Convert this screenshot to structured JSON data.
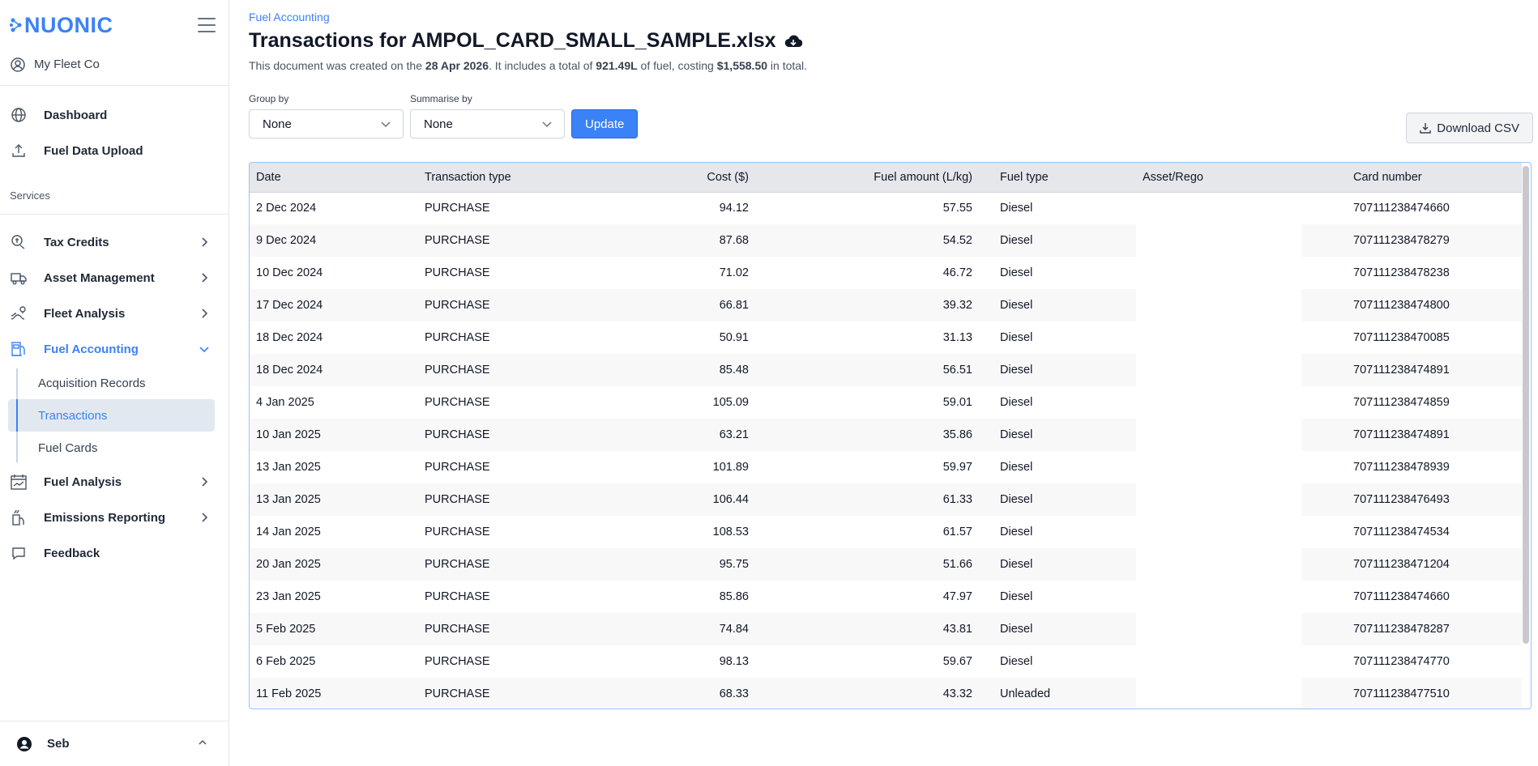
{
  "brand": {
    "logo_text": "NUONIC",
    "accent": "#3b82f6"
  },
  "sidebar": {
    "org_name": "My Fleet Co",
    "top_items": [
      {
        "label": "Dashboard",
        "icon": "globe-icon"
      },
      {
        "label": "Fuel Data Upload",
        "icon": "upload-icon"
      }
    ],
    "section_label": "Services",
    "items": [
      {
        "label": "Tax Credits",
        "icon": "tax-credits-icon"
      },
      {
        "label": "Asset Management",
        "icon": "truck-icon"
      },
      {
        "label": "Fleet Analysis",
        "icon": "route-icon"
      },
      {
        "label": "Fuel Accounting",
        "icon": "fuel-pump-icon",
        "active": true
      },
      {
        "label": "Fuel Analysis",
        "icon": "calendar-chart-icon"
      },
      {
        "label": "Emissions Reporting",
        "icon": "emissions-icon"
      },
      {
        "label": "Feedback",
        "icon": "chat-icon"
      }
    ],
    "fuel_accounting_sub": [
      "Acquisition Records",
      "Transactions",
      "Fuel Cards"
    ],
    "active_sub": "Transactions",
    "user_name": "Seb"
  },
  "main": {
    "breadcrumb": "Fuel Accounting",
    "title": "Transactions for AMPOL_CARD_SMALL_SAMPLE.xlsx",
    "subtitle": {
      "p1": "This document was created on the ",
      "date": "28 Apr 2026",
      "p2": ". It includes a total of ",
      "fuel": "921.49L",
      "p3": " of fuel, costing ",
      "cost": "$1,558.50",
      "p4": " in total."
    },
    "group_by": {
      "label": "Group by",
      "value": "None"
    },
    "summarise_by": {
      "label": "Summarise by",
      "value": "None"
    },
    "update_label": "Update",
    "download_label": "Download CSV"
  },
  "table": {
    "columns": [
      "Date",
      "Transaction type",
      "Cost ($)",
      "Fuel amount (L/kg)",
      "Fuel type",
      "Asset/Rego",
      "Card number"
    ],
    "rows": [
      [
        "2 Dec 2024",
        "PURCHASE",
        "94.12",
        "57.55",
        "Diesel",
        "",
        "707111238474660"
      ],
      [
        "9 Dec 2024",
        "PURCHASE",
        "87.68",
        "54.52",
        "Diesel",
        "",
        "707111238478279"
      ],
      [
        "10 Dec 2024",
        "PURCHASE",
        "71.02",
        "46.72",
        "Diesel",
        "",
        "707111238478238"
      ],
      [
        "17 Dec 2024",
        "PURCHASE",
        "66.81",
        "39.32",
        "Diesel",
        "",
        "707111238474800"
      ],
      [
        "18 Dec 2024",
        "PURCHASE",
        "50.91",
        "31.13",
        "Diesel",
        "",
        "707111238470085"
      ],
      [
        "18 Dec 2024",
        "PURCHASE",
        "85.48",
        "56.51",
        "Diesel",
        "",
        "707111238474891"
      ],
      [
        "4 Jan 2025",
        "PURCHASE",
        "105.09",
        "59.01",
        "Diesel",
        "",
        "707111238474859"
      ],
      [
        "10 Jan 2025",
        "PURCHASE",
        "63.21",
        "35.86",
        "Diesel",
        "",
        "707111238474891"
      ],
      [
        "13 Jan 2025",
        "PURCHASE",
        "101.89",
        "59.97",
        "Diesel",
        "",
        "707111238478939"
      ],
      [
        "13 Jan 2025",
        "PURCHASE",
        "106.44",
        "61.33",
        "Diesel",
        "",
        "707111238476493"
      ],
      [
        "14 Jan 2025",
        "PURCHASE",
        "108.53",
        "61.57",
        "Diesel",
        "",
        "707111238474534"
      ],
      [
        "20 Jan 2025",
        "PURCHASE",
        "95.75",
        "51.66",
        "Diesel",
        "",
        "707111238471204"
      ],
      [
        "23 Jan 2025",
        "PURCHASE",
        "85.86",
        "47.97",
        "Diesel",
        "",
        "707111238474660"
      ],
      [
        "5 Feb 2025",
        "PURCHASE",
        "74.84",
        "43.81",
        "Diesel",
        "",
        "707111238478287"
      ],
      [
        "6 Feb 2025",
        "PURCHASE",
        "98.13",
        "59.67",
        "Diesel",
        "",
        "707111238474770"
      ],
      [
        "11 Feb 2025",
        "PURCHASE",
        "68.33",
        "43.32",
        "Unleaded",
        "",
        "707111238477510"
      ]
    ]
  }
}
